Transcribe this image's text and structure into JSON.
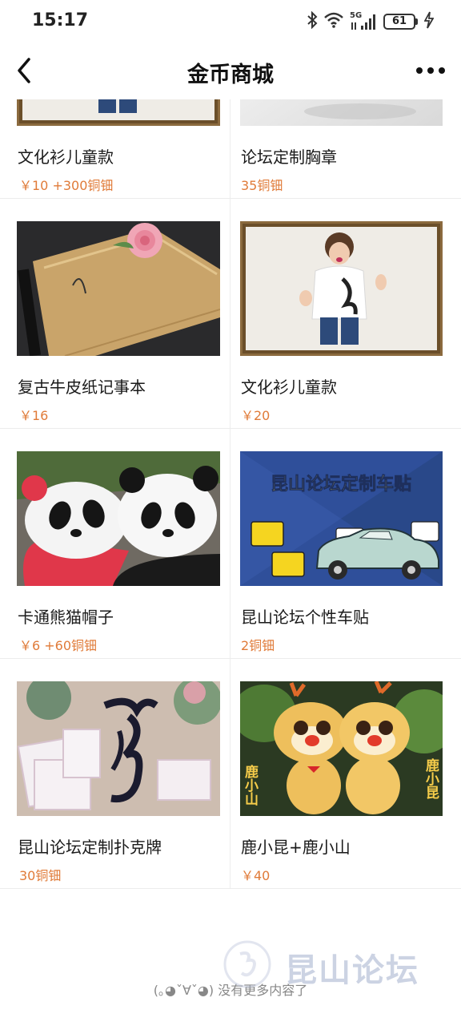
{
  "status_bar": {
    "time": "15:17",
    "network": "5G",
    "battery": "61",
    "icons": [
      "bluetooth-icon",
      "wifi-icon",
      "signal-icon",
      "battery-icon",
      "charging-icon"
    ]
  },
  "nav": {
    "title": "金币商城",
    "back_icon": "back-arrow-icon",
    "more_icon": "more-dots-icon"
  },
  "accent_color": "#e07b39",
  "products": [
    {
      "name": "文化衫儿童款",
      "price": "￥10 +300铜钿",
      "image": "child-tshirt-photo"
    },
    {
      "name": "论坛定制胸章",
      "price": "35铜钿",
      "image": "badge-photo"
    },
    {
      "name": "复古牛皮纸记事本",
      "price": "￥16",
      "image": "notebook-photo"
    },
    {
      "name": "文化衫儿童款",
      "price": "￥20",
      "image": "child-tshirt-photo"
    },
    {
      "name": "卡通熊猫帽子",
      "price": "￥6 +60铜钿",
      "image": "panda-caps-photo"
    },
    {
      "name": "昆山论坛个性车贴",
      "price": "2铜钿",
      "image": "car-sticker-banner"
    },
    {
      "name": "昆山论坛定制扑克牌",
      "price": "30铜钿",
      "image": "playing-cards-photo"
    },
    {
      "name": "鹿小昆+鹿小山",
      "price": "￥40",
      "image": "deer-plush-photo"
    }
  ],
  "banner_text": "昆山论坛定制车贴",
  "deer_labels": {
    "left": "鹿小山",
    "right": "鹿小昆"
  },
  "footer": "(｡◕ˇ∀ˇ◕) 没有更多内容了",
  "watermark": "昆山论坛"
}
